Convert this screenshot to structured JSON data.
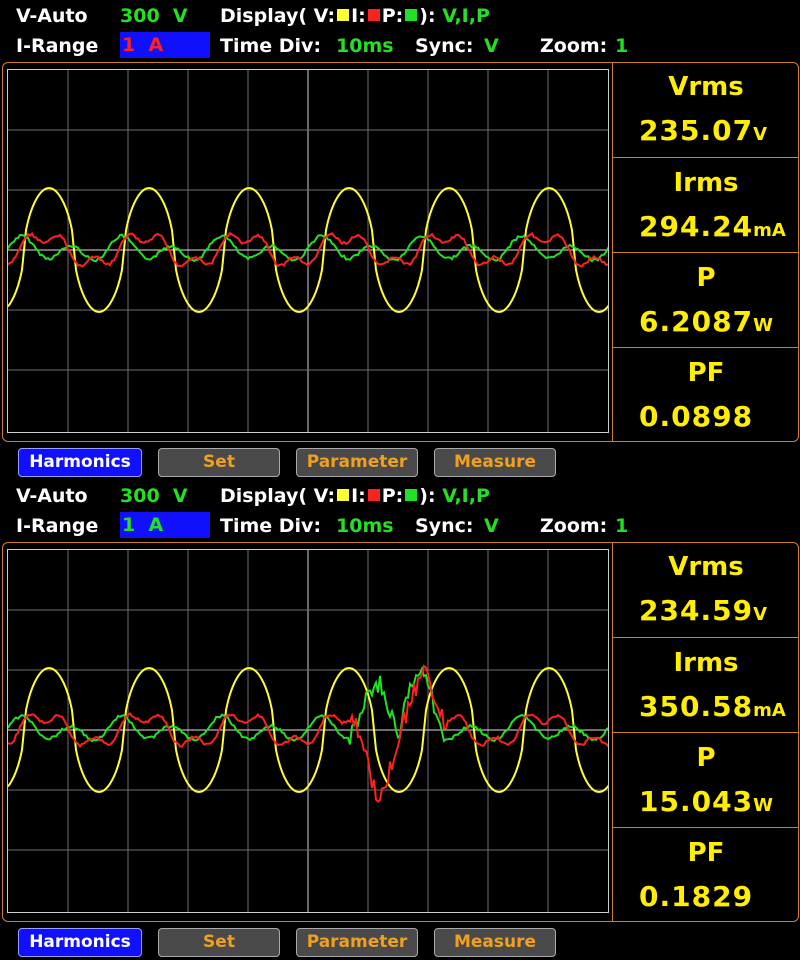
{
  "panels": [
    {
      "header": {
        "range_mode": "V-Auto",
        "voltage_range": "300",
        "voltage_unit": "V",
        "display_label": "Display( V:",
        "display_i": "I:",
        "display_p": "P:",
        "display_close": "):",
        "display_value": "V,I,P",
        "i_range_label": "I-Range",
        "i_range_value": "1",
        "i_range_unit": "A",
        "time_div_label": "Time  Div:",
        "time_div_value": "10ms",
        "sync_label": "Sync:",
        "sync_value": "V",
        "zoom_label": "Zoom:",
        "zoom_value": "1"
      },
      "measurements": [
        {
          "label": "Vrms",
          "value": "235.07",
          "unit": "V"
        },
        {
          "label": "Irms",
          "value": "294.24",
          "unit": "mA"
        },
        {
          "label": "P",
          "value": "6.2087",
          "unit": "W"
        },
        {
          "label": "PF",
          "value": "0.0898",
          "unit": ""
        }
      ],
      "buttons": {
        "harmonics": "Harmonics",
        "set": "Set",
        "parameter": "Parameter",
        "measure": "Measure"
      }
    },
    {
      "header": {
        "range_mode": "V-Auto",
        "voltage_range": "300",
        "voltage_unit": "V",
        "display_label": "Display( V:",
        "display_i": "I:",
        "display_p": "P:",
        "display_close": "):",
        "display_value": "V,I,P",
        "i_range_label": "I-Range",
        "i_range_value": "1",
        "i_range_unit": "A",
        "time_div_label": "Time  Div:",
        "time_div_value": "10ms",
        "sync_label": "Sync:",
        "sync_value": "V",
        "zoom_label": "Zoom:",
        "zoom_value": "1"
      },
      "measurements": [
        {
          "label": "Vrms",
          "value": "234.59",
          "unit": "V"
        },
        {
          "label": "Irms",
          "value": "350.58",
          "unit": "mA"
        },
        {
          "label": "P",
          "value": "15.043",
          "unit": "W"
        },
        {
          "label": "PF",
          "value": "0.1829",
          "unit": ""
        }
      ],
      "buttons": {
        "harmonics": "Harmonics",
        "set": "Set",
        "parameter": "Parameter",
        "measure": "Measure"
      }
    }
  ],
  "colors": {
    "voltage_trace": "#ffff33",
    "current_trace": "#ff2020",
    "power_trace": "#22e022",
    "frame": "#d08020",
    "measurement_text": "#ffee00",
    "active_button": "#1010ff"
  },
  "waveform": {
    "cycles_shown": 6,
    "sync": "V"
  }
}
